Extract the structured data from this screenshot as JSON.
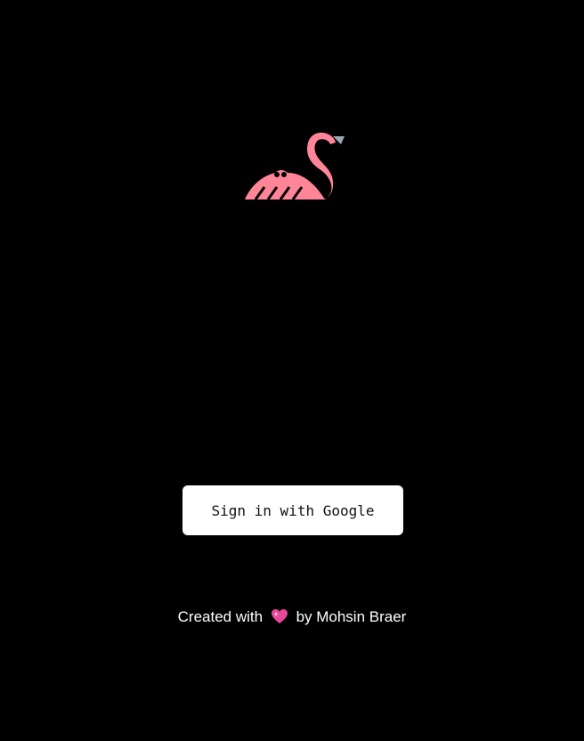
{
  "logo": {
    "icon": "flamingo-icon",
    "color": "#FF8597",
    "beak_color": "#9AA9B8"
  },
  "signin": {
    "label": "Sign in with Google"
  },
  "footer": {
    "prefix": "Created with",
    "heart_icon": "sparkling-heart-icon",
    "heart_color": "#E8479A",
    "suffix": "by Mohsin Braer"
  },
  "colors": {
    "background": "#000000",
    "button_background": "#FFFFFF",
    "footer_text": "#FFFFFF"
  }
}
